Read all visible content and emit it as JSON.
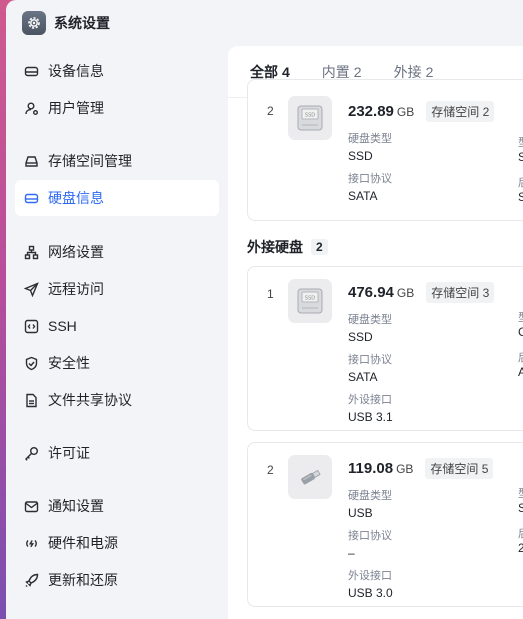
{
  "app": {
    "title": "系统设置"
  },
  "sidebar": {
    "items": [
      {
        "label": "设备信息",
        "icon": "device-icon"
      },
      {
        "label": "用户管理",
        "icon": "user-icon"
      },
      {
        "label": "存储空间管理",
        "icon": "storage-icon"
      },
      {
        "label": "硬盘信息",
        "icon": "disk-icon",
        "active": true
      },
      {
        "label": "网络设置",
        "icon": "network-icon"
      },
      {
        "label": "远程访问",
        "icon": "send-icon"
      },
      {
        "label": "SSH",
        "icon": "terminal-icon"
      },
      {
        "label": "安全性",
        "icon": "shield-icon"
      },
      {
        "label": "文件共享协议",
        "icon": "file-icon"
      },
      {
        "label": "许可证",
        "icon": "key-icon"
      },
      {
        "label": "通知设置",
        "icon": "mail-icon"
      },
      {
        "label": "硬件和电源",
        "icon": "power-icon"
      },
      {
        "label": "更新和还原",
        "icon": "rocket-icon"
      }
    ]
  },
  "tabs": [
    {
      "label": "全部",
      "count": "4",
      "active": true
    },
    {
      "label": "内置",
      "count": "2"
    },
    {
      "label": "外接",
      "count": "2"
    }
  ],
  "labels": {
    "disk_type": "硬盘类型",
    "interface": "接口协议",
    "external_port": "外设接口"
  },
  "internal_partial": {
    "index": "2",
    "capacity": "232.89",
    "unit": "GB",
    "pool": "存储空间 2",
    "disk_type": "SSD",
    "interface": "SATA",
    "thumb_text": "SSD",
    "right_k1": "型",
    "right_v1": "S",
    "right_k2": "后",
    "right_v2": "S"
  },
  "external_section": {
    "title": "外接硬盘",
    "count": "2"
  },
  "external_disks": [
    {
      "index": "1",
      "capacity": "476.94",
      "unit": "GB",
      "pool": "存储空间 3",
      "disk_type": "SSD",
      "interface": "SATA",
      "external_port": "USB 3.1",
      "thumb_text": "SSD",
      "right_k1": "型",
      "right_v1": "C",
      "right_k2": "后",
      "right_v2": "A"
    },
    {
      "index": "2",
      "capacity": "119.08",
      "unit": "GB",
      "pool": "存储空间 5",
      "disk_type": "USB",
      "interface": "–",
      "external_port": "USB 3.0",
      "right_k1": "型",
      "right_v1": "S",
      "right_k2": "后",
      "right_v2": "2"
    }
  ]
}
